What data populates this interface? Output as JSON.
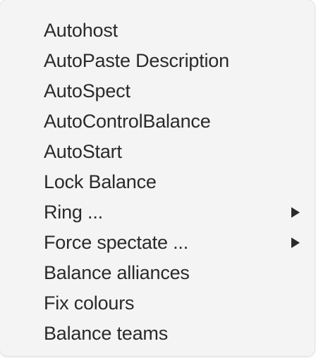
{
  "menu": {
    "items": [
      {
        "label": "Autohost",
        "has_submenu": false
      },
      {
        "label": "AutoPaste Description",
        "has_submenu": false
      },
      {
        "label": "AutoSpect",
        "has_submenu": false
      },
      {
        "label": "AutoControlBalance",
        "has_submenu": false
      },
      {
        "label": "AutoStart",
        "has_submenu": false
      },
      {
        "label": "Lock Balance",
        "has_submenu": false
      },
      {
        "label": "Ring ...",
        "has_submenu": true
      },
      {
        "label": "Force spectate ...",
        "has_submenu": true
      },
      {
        "label": "Balance alliances",
        "has_submenu": false
      },
      {
        "label": "Fix colours",
        "has_submenu": false
      },
      {
        "label": "Balance teams",
        "has_submenu": false
      }
    ],
    "arrow_icon": "triangle-right-icon",
    "text_color": "#2a2a2a",
    "background_color": "#f4f4f4"
  }
}
